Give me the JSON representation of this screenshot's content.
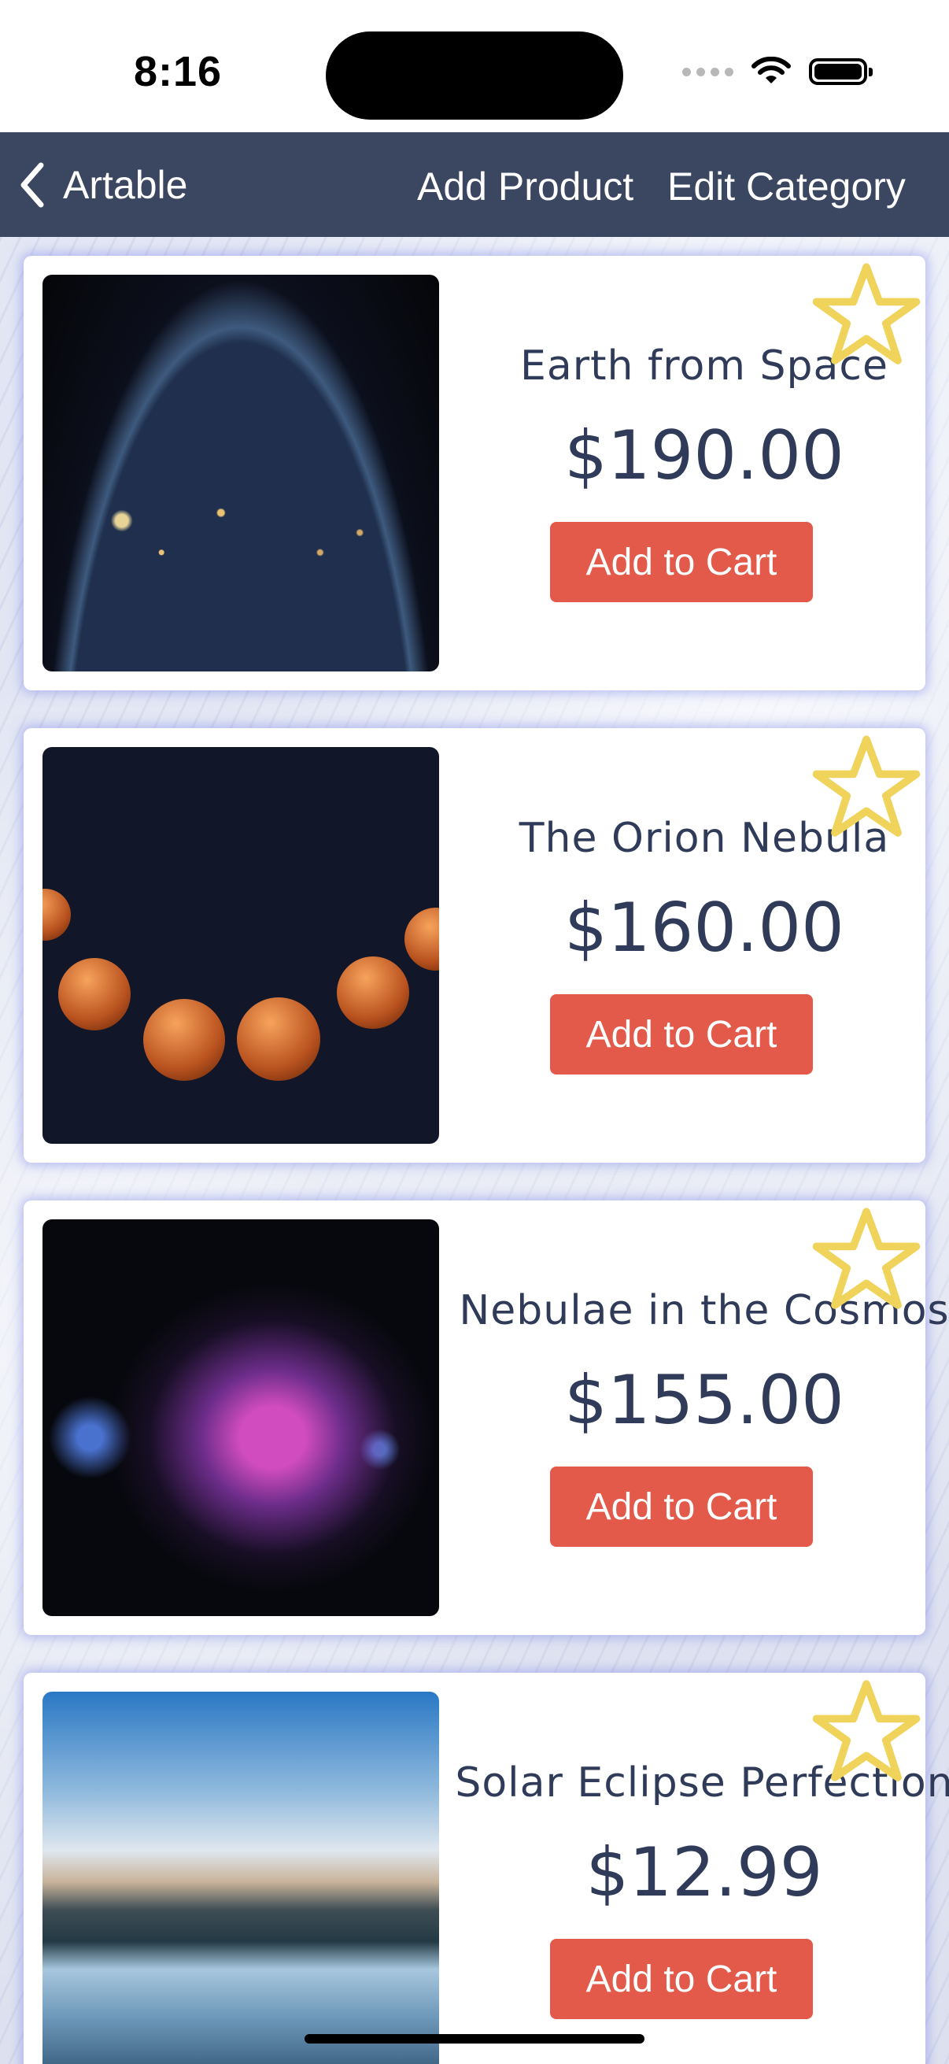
{
  "status_bar": {
    "time": "8:16"
  },
  "nav": {
    "back_label": "Artable",
    "add_product": "Add Product",
    "edit_category": "Edit Category"
  },
  "colors": {
    "nav_background": "#3b4661",
    "text_primary": "#2f3b58",
    "cart_button": "#e3594a",
    "star_outline": "#efd35a"
  },
  "products": [
    {
      "title": "Earth from Space",
      "price": "$190.00",
      "button": "Add to Cart",
      "favorite_icon": "star-outline-icon"
    },
    {
      "title": "The Orion Nebula",
      "price": "$160.00",
      "button": "Add to Cart",
      "favorite_icon": "star-outline-icon"
    },
    {
      "title": "Nebulae in the Cosmos",
      "price": "$155.00",
      "button": "Add to Cart",
      "favorite_icon": "star-outline-icon"
    },
    {
      "title": "Solar Eclipse Perfection",
      "price": "$12.99",
      "button": "Add to Cart",
      "favorite_icon": "star-outline-icon"
    }
  ]
}
